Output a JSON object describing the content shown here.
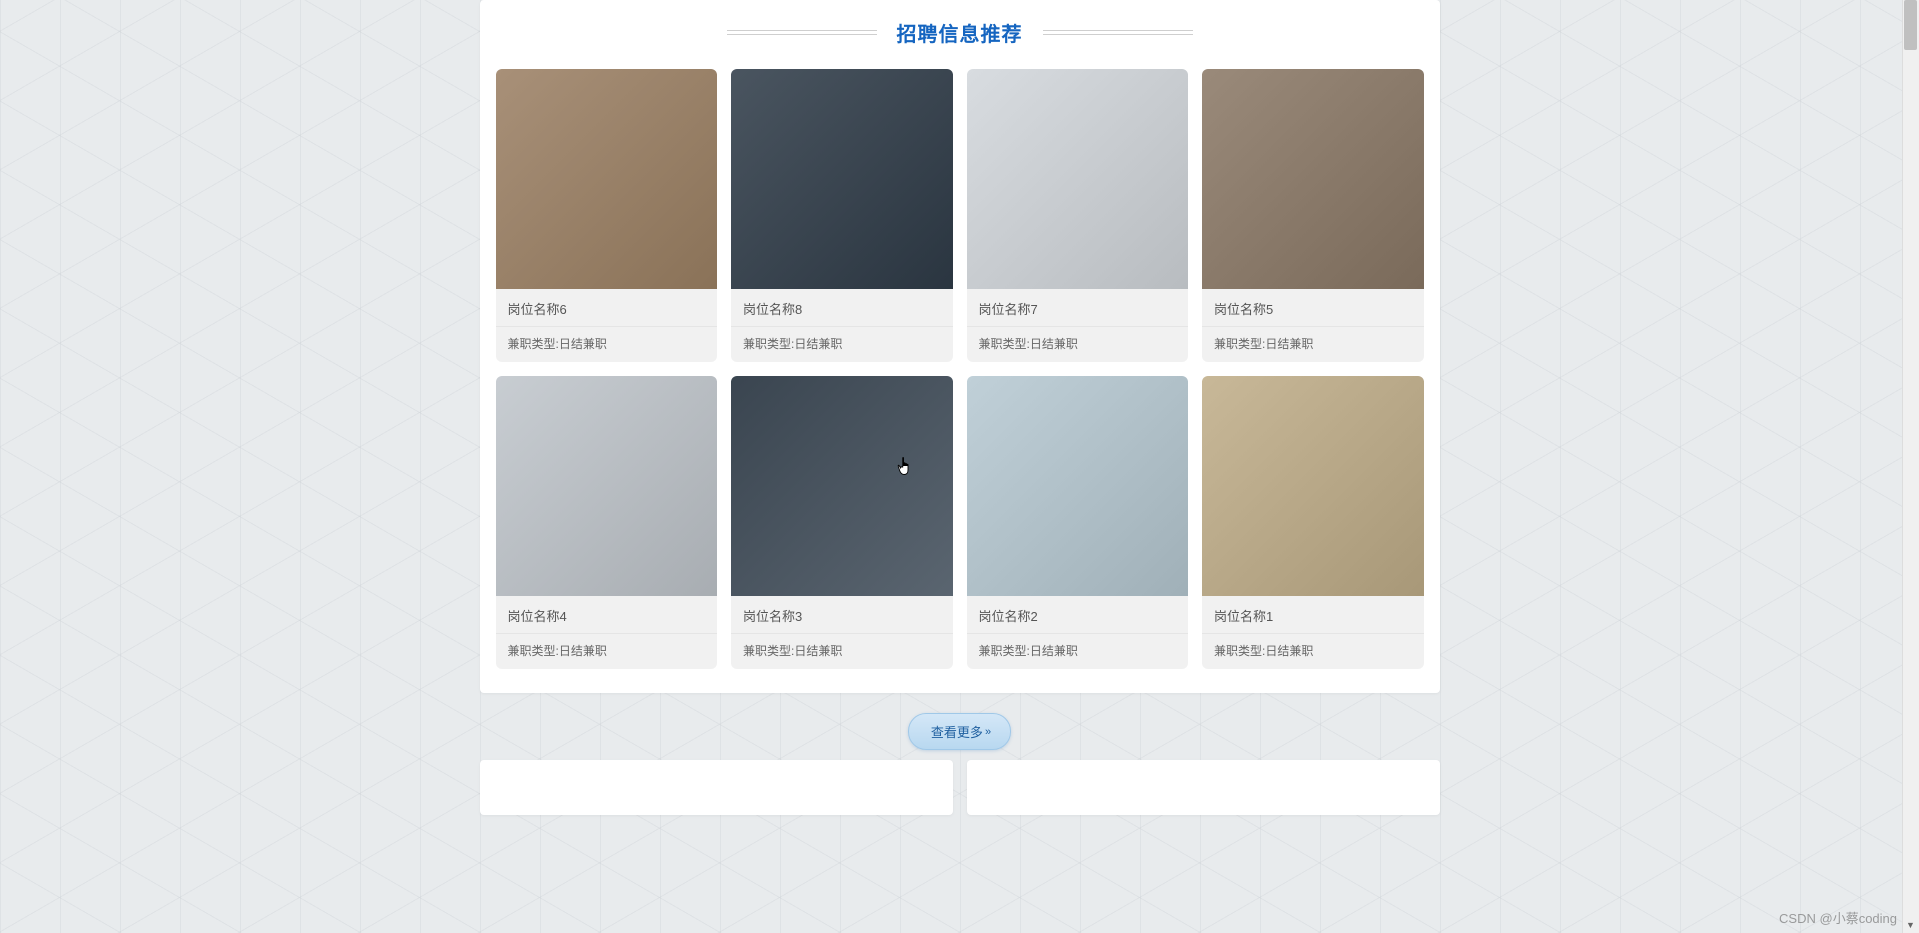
{
  "section": {
    "title": "招聘信息推荐"
  },
  "jobs": [
    {
      "title": "岗位名称6",
      "type": "兼职类型:日结兼职"
    },
    {
      "title": "岗位名称8",
      "type": "兼职类型:日结兼职"
    },
    {
      "title": "岗位名称7",
      "type": "兼职类型:日结兼职"
    },
    {
      "title": "岗位名称5",
      "type": "兼职类型:日结兼职"
    },
    {
      "title": "岗位名称4",
      "type": "兼职类型:日结兼职"
    },
    {
      "title": "岗位名称3",
      "type": "兼职类型:日结兼职"
    },
    {
      "title": "岗位名称2",
      "type": "兼职类型:日结兼职"
    },
    {
      "title": "岗位名称1",
      "type": "兼职类型:日结兼职"
    }
  ],
  "moreButton": {
    "label": "查看更多"
  },
  "watermark": "CSDN @小蔡coding"
}
